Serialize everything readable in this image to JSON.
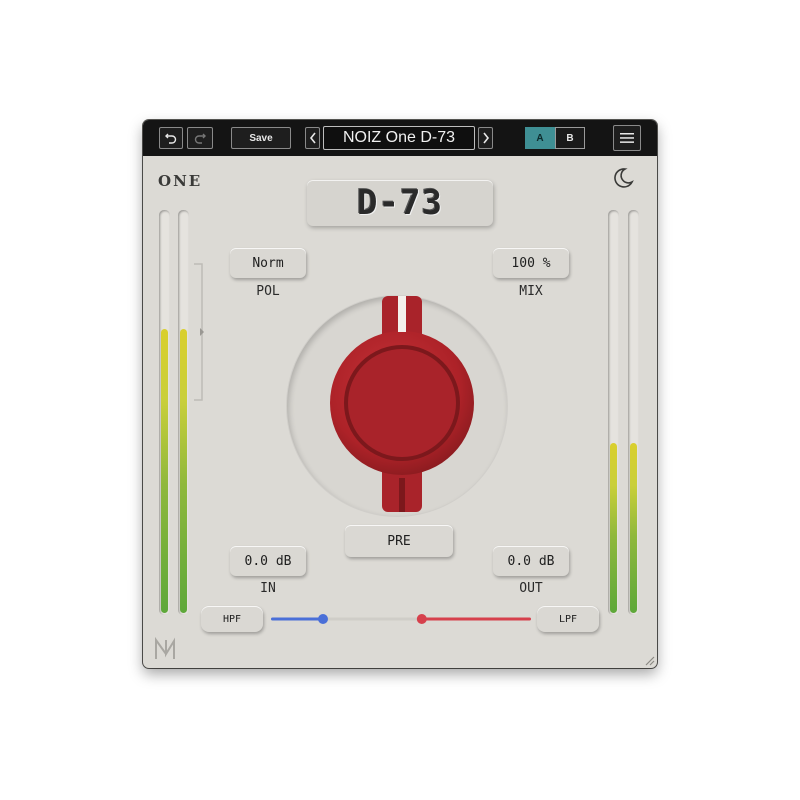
{
  "toolbar": {
    "undo_icon": "undo-icon",
    "redo_icon": "redo-icon",
    "save_label": "Save",
    "prev_icon": "chevron-left-icon",
    "next_icon": "chevron-right-icon",
    "preset_name": "NOIZ One D-73",
    "ab_a_label": "A",
    "ab_b_label": "B",
    "menu_icon": "hamburger-menu-icon",
    "ab_active": "A"
  },
  "brand": {
    "series_label": "ONE",
    "theme_icon": "moon-icon"
  },
  "plugin": {
    "title": "D-73"
  },
  "controls": {
    "pol": {
      "value": "Norm",
      "label": "POL"
    },
    "mix": {
      "value": "100 %",
      "label": "MIX"
    },
    "in": {
      "value": "0.0 dB",
      "label": "IN"
    },
    "out": {
      "value": "0.0 dB",
      "label": "OUT"
    },
    "pre_label": "PRE",
    "hpf_label": "HPF",
    "lpf_label": "LPF"
  },
  "meters": {
    "input_left_level": 0.71,
    "input_right_level": 0.71,
    "output_left_level": 0.43,
    "output_right_level": 0.43
  },
  "filter": {
    "hpf_position": 0.2,
    "lpf_position": 0.58
  },
  "colors": {
    "panel": "#dcdad5",
    "knob_red": "#b3242a",
    "accent_teal": "#3f8f94",
    "hpf_blue": "#4a6fd8",
    "lpf_red": "#d6404c",
    "meter_yellow": "#d9cf2d",
    "meter_green": "#5ea83a"
  }
}
